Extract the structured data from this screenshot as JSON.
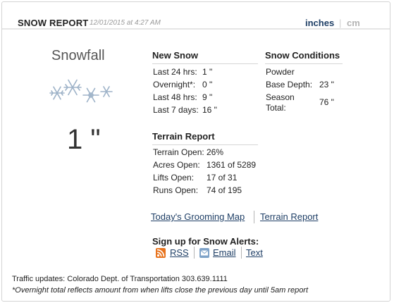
{
  "header": {
    "title": "SNOW REPORT",
    "timestamp": "12/01/2015 at 4:27 AM",
    "unit_inches": "inches",
    "unit_separator": "|",
    "unit_cm": "cm"
  },
  "snowfall": {
    "label": "Snowfall",
    "amount": "1 \""
  },
  "new_snow": {
    "heading": "New Snow",
    "rows": [
      {
        "label": "Last 24 hrs:",
        "value": "1 \""
      },
      {
        "label": "Overnight*:",
        "value": "0 \""
      },
      {
        "label": "Last 48 hrs:",
        "value": "9 \""
      },
      {
        "label": "Last 7 days:",
        "value": "16 \""
      }
    ]
  },
  "snow_conditions": {
    "heading": "Snow Conditions",
    "surface": "Powder",
    "base_label": "Base Depth:",
    "base_value": "23 \"",
    "season_label_1": "Season",
    "season_label_2": "Total:",
    "season_value": "76 \""
  },
  "terrain": {
    "heading": "Terrain Report",
    "rows": [
      {
        "label": "Terrain Open:",
        "value": "26%"
      },
      {
        "label": "Acres Open:",
        "value": "1361 of 5289"
      },
      {
        "label": "Lifts Open:",
        "value": "17 of 31"
      },
      {
        "label": "Runs Open:",
        "value": "74 of 195"
      }
    ]
  },
  "links": {
    "grooming": "Today's Grooming Map",
    "terrain_report": "Terrain Report"
  },
  "alerts": {
    "heading": "Sign up for Snow Alerts:",
    "rss": "RSS",
    "email": "Email",
    "text": "Text",
    "rss_color": "#e8741e",
    "email_color": "#7fa3c8"
  },
  "footer": {
    "traffic": "Traffic updates: Colorado Dept. of Transportation 303.639.1111",
    "note": "*Overnight total reflects amount from when lifts close the previous day until 5am report"
  },
  "icons": {
    "snowflakes": "snowflake-icon"
  }
}
